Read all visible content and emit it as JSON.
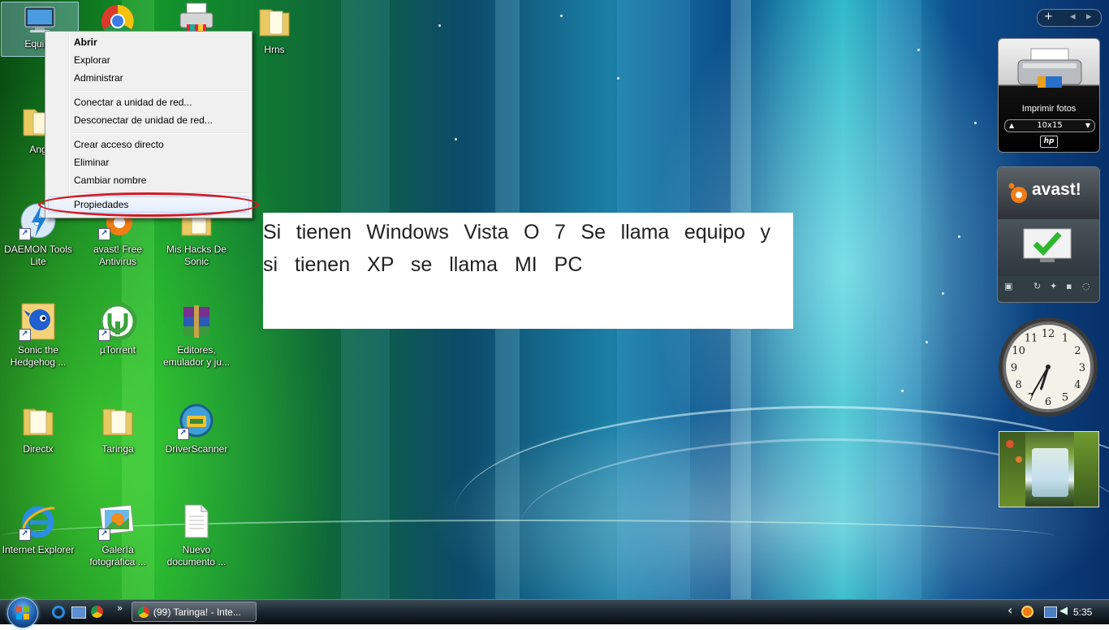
{
  "desktop_icons": [
    {
      "label": "Equipo"
    },
    {
      "label": ""
    },
    {
      "label": ""
    },
    {
      "label": "Hrns"
    },
    {
      "label": "Ang"
    },
    {
      "label": "DAEMON Tools Lite"
    },
    {
      "label": "avast! Free Antivirus"
    },
    {
      "label": "Mis Hacks De Sonic"
    },
    {
      "label": "Sonic the Hedgehog ..."
    },
    {
      "label": "µTorrent"
    },
    {
      "label": "Editores, emulador y ju..."
    },
    {
      "label": "Directx"
    },
    {
      "label": "Taringa"
    },
    {
      "label": "DriverScanner"
    },
    {
      "label": "Internet Explorer"
    },
    {
      "label": "Galería fotográfica ..."
    },
    {
      "label": "Nuevo documento ..."
    }
  ],
  "context_menu": {
    "items": [
      {
        "label": "Abrir"
      },
      {
        "label": "Explorar"
      },
      {
        "label": "Administrar"
      },
      {
        "label": "Conectar a unidad de red..."
      },
      {
        "label": "Desconectar de unidad de red..."
      },
      {
        "label": "Crear acceso directo"
      },
      {
        "label": "Eliminar"
      },
      {
        "label": "Cambiar nombre"
      },
      {
        "label": "Propiedades"
      }
    ],
    "highlight_color": "#d41a24"
  },
  "note": {
    "line1": "Si tienen Windows Vista O 7 Se llama equipo y",
    "line2": "si tienen XP se llama MI PC"
  },
  "gadgets": {
    "controls": {
      "add": "+",
      "prev": "◂",
      "next": "▸"
    },
    "printer": {
      "title": "Imprimir fotos",
      "size": "10x15",
      "brand": "hp"
    },
    "avast": {
      "brand": "avast!"
    },
    "clock": {
      "numbers": [
        "12",
        "1",
        "2",
        "3",
        "4",
        "5",
        "6",
        "7",
        "8",
        "9",
        "10",
        "11"
      ],
      "hour": 6,
      "minute": 35
    }
  },
  "taskbar": {
    "window_title": "(99) Taringa! - Inte...",
    "more": "»",
    "tray_arrow": "‹",
    "time": "5:35"
  }
}
